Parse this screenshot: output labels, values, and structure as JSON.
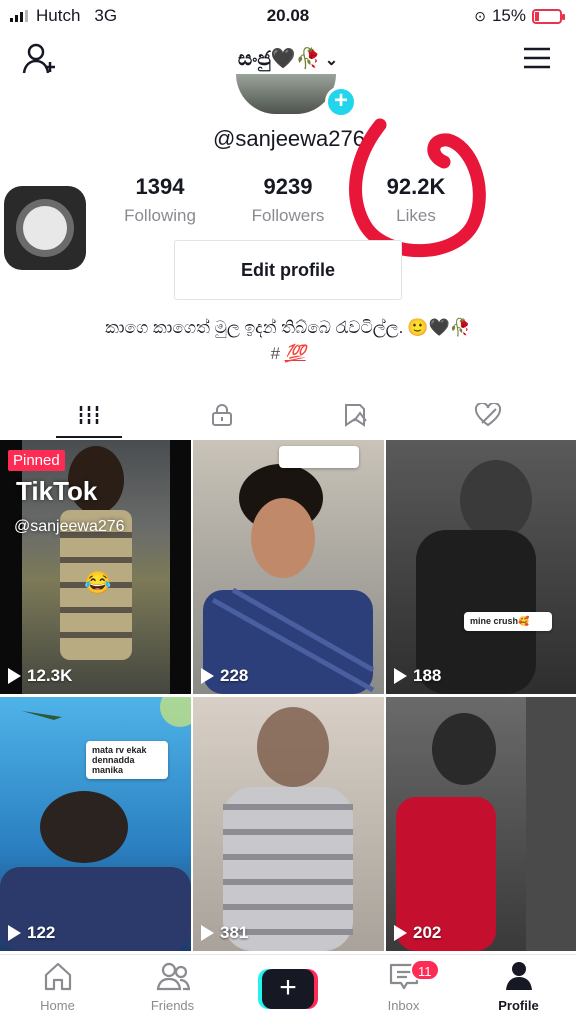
{
  "status_bar": {
    "carrier": "Hutch",
    "network": "3G",
    "time": "20.08",
    "battery": "15%",
    "battery_level": 0.15
  },
  "header": {
    "title": "සංජු🖤🥀",
    "add_friend_icon": "person-plus-icon",
    "menu_icon": "hamburger-icon"
  },
  "profile": {
    "username": "@sanjeewa276",
    "stats": [
      {
        "value": "1394",
        "label": "Following"
      },
      {
        "value": "9239",
        "label": "Followers"
      },
      {
        "value": "92.2K",
        "label": "Likes"
      }
    ],
    "edit_label": "Edit profile",
    "bio": "කාගෙ කාගෙත් මුල ඉදන් තිබ්බෙ රැවටිල්ල.",
    "bio_emojis": "🙂🖤🥀",
    "hashtag_prefix": "# ",
    "hashtag": "💯"
  },
  "tabs": [
    {
      "name": "videos",
      "icon": "grid-icon",
      "active": true
    },
    {
      "name": "private",
      "icon": "lock-icon",
      "active": false
    },
    {
      "name": "favorites",
      "icon": "bookmark-hidden-icon",
      "active": false
    },
    {
      "name": "liked",
      "icon": "heart-hidden-icon",
      "active": false
    }
  ],
  "videos": [
    {
      "views": "12.3K",
      "pinned_label": "Pinned",
      "watermark": "TikTok",
      "watermark_user": "@sanjeewa276"
    },
    {
      "views": "228"
    },
    {
      "views": "188",
      "comment": "mine crush🥰"
    },
    {
      "views": "122",
      "comment": "mata rv ekak dennadda manika"
    },
    {
      "views": "381"
    },
    {
      "views": "202"
    }
  ],
  "nav": {
    "home": "Home",
    "friends": "Friends",
    "create": "+",
    "inbox": "Inbox",
    "inbox_badge": "11",
    "profile": "Profile"
  },
  "colors": {
    "accent": "#fe2c55",
    "cyan": "#25f4ee",
    "annotation": "#e8173a"
  }
}
